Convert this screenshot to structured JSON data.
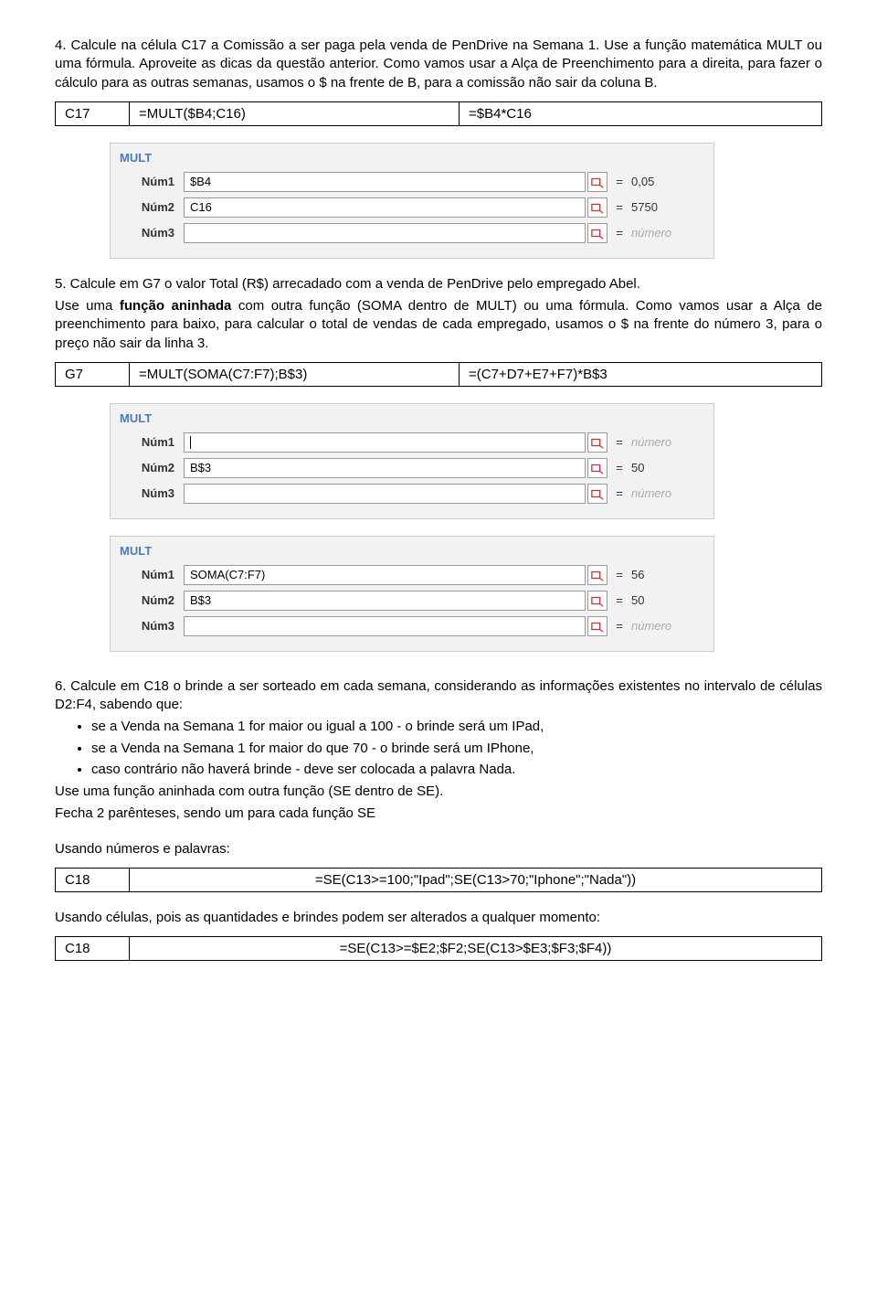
{
  "q4": {
    "p1": "4. Calcule na célula C17 a Comissão a ser paga pela venda de PenDrive na Semana 1. Use a função matemática MULT ou uma fórmula. Aproveite as dicas da questão anterior. Como vamos usar a Alça de Preenchimento para a direita, para fazer o cálculo para as outras semanas, usamos o $ na frente de B, para a comissão não sair da coluna B.",
    "table": {
      "cell": "C17",
      "f1": "=MULT($B4;C16)",
      "f2": "=$B4*C16"
    },
    "mult": {
      "title": "MULT",
      "rows": [
        {
          "label": "Núm1",
          "value": "$B4",
          "result": "0,05"
        },
        {
          "label": "Núm2",
          "value": "C16",
          "result": "5750"
        },
        {
          "label": "Núm3",
          "value": "",
          "result": "número",
          "dim": true
        }
      ]
    }
  },
  "q5": {
    "p1": "5. Calcule em G7 o valor Total (R$) arrecadado com a venda de PenDrive pelo empregado Abel.",
    "p2a": "Use uma ",
    "p2bold": "função aninhada",
    "p2b": " com outra função (SOMA dentro de MULT) ou uma fórmula. Como vamos usar a Alça de preenchimento para baixo, para calcular o total de vendas de cada empregado, usamos o $ na frente do número 3, para o preço não sair da linha 3.",
    "table": {
      "cell": "G7",
      "f1": "=MULT(SOMA(C7:F7);B$3)",
      "f2": "=(C7+D7+E7+F7)*B$3"
    },
    "mult1": {
      "title": "MULT",
      "rows": [
        {
          "label": "Núm1",
          "value": "",
          "cursor": true,
          "result": "número",
          "dim": true
        },
        {
          "label": "Núm2",
          "value": "B$3",
          "result": "50"
        },
        {
          "label": "Núm3",
          "value": "",
          "result": "número",
          "dim": true
        }
      ]
    },
    "mult2": {
      "title": "MULT",
      "rows": [
        {
          "label": "Núm1",
          "value": "SOMA(C7:F7)",
          "result": "56"
        },
        {
          "label": "Núm2",
          "value": "B$3",
          "result": "50"
        },
        {
          "label": "Núm3",
          "value": "",
          "result": "número",
          "dim": true
        }
      ]
    }
  },
  "q6": {
    "p1": "6. Calcule em C18 o brinde a ser sorteado em cada semana, considerando as informações existentes no intervalo de células D2:F4, sabendo que:",
    "b1": "se a Venda na Semana 1 for maior ou igual a 100 - o brinde será um IPad,",
    "b2": "se a Venda na Semana 1 for maior do que 70 - o brinde será um IPhone,",
    "b3": "caso contrário não haverá brinde - deve ser colocada a palavra Nada.",
    "p2": "Use uma função aninhada com outra função (SE dentro de SE).",
    "p3": "Fecha 2 parênteses, sendo um para cada função SE",
    "h1": "Usando números e palavras:",
    "table1": {
      "cell": "C18",
      "f": "=SE(C13>=100;\"Ipad\";SE(C13>70;\"Iphone\";\"Nada\"))"
    },
    "h2": "Usando células, pois as quantidades e brindes podem ser alterados a qualquer momento:",
    "table2": {
      "cell": "C18",
      "f": "=SE(C13>=$E2;$F2;SE(C13>$E3;$F3;$F4))"
    }
  }
}
